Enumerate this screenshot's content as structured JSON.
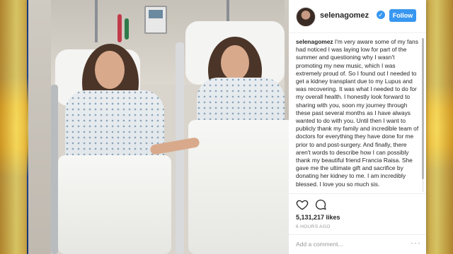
{
  "post": {
    "username": "selenagomez",
    "verified_mark": "✓",
    "follow_label": "Follow",
    "caption_user": "selenagomez",
    "caption_text": " I'm very aware some of my fans had noticed I was laying low for part of the summer and questioning why I wasn't promoting my new music, which I was extremely proud of. So I found out I needed to get a kidney transplant due to my Lupus and was recovering. It was what I needed to do for my overall health. I honestly look forward to sharing with you, soon my journey through these past several months as I have always wanted to do with you. Until then I want to publicly thank my family and incredible team of doctors for everything they have done for me prior to and post-surgery. And finally, there aren't words to describe how I can possibly thank my beautiful friend Francia Raisa. She gave me the ultimate gift and sacrifice by donating her kidney to me. I am incredibly blessed. I love you so much sis.",
    "likes": "5,131,217 likes",
    "time": "6 HOURS AGO",
    "comment_placeholder": "Add a comment...",
    "more_label": "···"
  },
  "icons": {
    "heart": "heart-icon",
    "comment": "comment-icon",
    "more": "more-options-icon"
  },
  "colors": {
    "accent": "#3897f0",
    "text": "#262626",
    "muted": "#999999"
  }
}
